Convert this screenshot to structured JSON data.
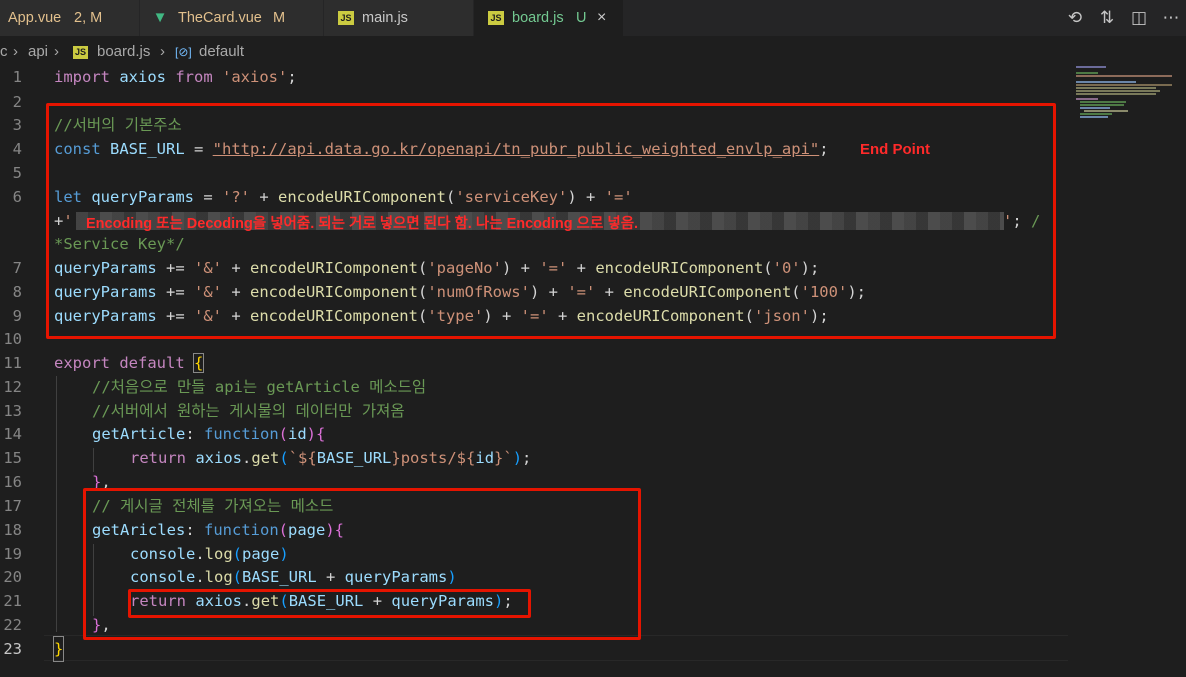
{
  "tabs": [
    {
      "name": "App.vue",
      "status": "2, M",
      "icon": "vue-icon",
      "active": false
    },
    {
      "name": "TheCard.vue",
      "status": "M",
      "icon": "vue-icon",
      "active": false
    },
    {
      "name": "main.js",
      "status": "",
      "icon": "js-icon",
      "active": false
    },
    {
      "name": "board.js",
      "status": "U",
      "icon": "js-icon",
      "active": true
    }
  ],
  "tab_close": "×",
  "editor_actions": [
    "timeline-icon",
    "compare-changes-icon",
    "split-editor-icon",
    "more-actions-icon"
  ],
  "breadcrumb": {
    "root": "c",
    "sep": "›",
    "folder": "api",
    "file": "board.js",
    "js": "JS",
    "symbol": "default"
  },
  "line_numbers": [
    "1",
    "2",
    "3",
    "4",
    "5",
    "6",
    "7",
    "8",
    "9",
    "10",
    "11",
    "12",
    "13",
    "14",
    "15",
    "16",
    "17",
    "18",
    "19",
    "20",
    "21",
    "22",
    "23"
  ],
  "code": {
    "l1": [
      "import",
      " axios ",
      "from",
      " ",
      "'axios'",
      ";"
    ],
    "l3": "//서버의 기본주소",
    "l4": [
      "const",
      " ",
      "BASE_URL",
      " = ",
      "\"http://api.data.go.kr/openapi/tn_pubr_public_weighted_envlp_api\"",
      ";"
    ],
    "l6": [
      "let",
      " ",
      "queryParams",
      " = ",
      "'?'",
      " + ",
      "encodeURIComponent",
      "(",
      "'serviceKey'",
      ")",
      " + ",
      "'='"
    ],
    "l6b": [
      "+",
      "'"
    ],
    "l6c": [
      "'",
      ";",
      " /"
    ],
    "l6d": "*Service Key*/",
    "l7": [
      "queryParams",
      " += ",
      "'&'",
      " + ",
      "encodeURIComponent",
      "(",
      "'pageNo'",
      ")",
      " + ",
      "'='",
      " + ",
      "encodeURIComponent",
      "(",
      "'0'",
      ")",
      ";"
    ],
    "l8": [
      "queryParams",
      " += ",
      "'&'",
      " + ",
      "encodeURIComponent",
      "(",
      "'numOfRows'",
      ")",
      " + ",
      "'='",
      " + ",
      "encodeURIComponent",
      "(",
      "'100'",
      ")",
      ";"
    ],
    "l9": [
      "queryParams",
      " += ",
      "'&'",
      " + ",
      "encodeURIComponent",
      "(",
      "'type'",
      ")",
      " + ",
      "'='",
      " + ",
      "encodeURIComponent",
      "(",
      "'json'",
      ")",
      ";"
    ],
    "l11": [
      "export",
      " ",
      "default",
      " ",
      "{"
    ],
    "l12": "//처음으로 만들 api는 getArticle 메소드임",
    "l13": "//서버에서 원하는 게시물의 데이터만 가져옴",
    "l14": [
      "getArticle",
      ": ",
      "function",
      "(",
      "id",
      ")",
      "{"
    ],
    "l15": [
      "return",
      " ",
      "axios",
      ".",
      "get",
      "(",
      "`${",
      "BASE_URL",
      "}posts/${",
      "id",
      "}`",
      ")",
      ";"
    ],
    "l16": [
      "}",
      ","
    ],
    "l17": "// 게시글 전체를 가져오는 메소드",
    "l18": [
      "getAricles",
      ": ",
      "function",
      "(",
      "page",
      ")",
      "{"
    ],
    "l19": [
      "console",
      ".",
      "log",
      "(",
      "page",
      ")"
    ],
    "l20": [
      "console",
      ".",
      "log",
      "(",
      "BASE_URL",
      " + ",
      "queryParams",
      ")"
    ],
    "l21": [
      "return",
      " ",
      "axios",
      ".",
      "get",
      "(",
      "BASE_URL",
      " + ",
      "queryParams",
      ")",
      ";"
    ],
    "l22": [
      "}",
      ","
    ],
    "l23": "}"
  },
  "annotations": {
    "endpoint": "End Point",
    "encoding": "Encoding 또는 Decoding을 넣어줌. 되는 거로 넣으면 된다 함. 나는 Encoding 으로 넣음."
  },
  "colors": {
    "highlight_box": "#e51400",
    "annotation_text": "#ff2a2a"
  }
}
